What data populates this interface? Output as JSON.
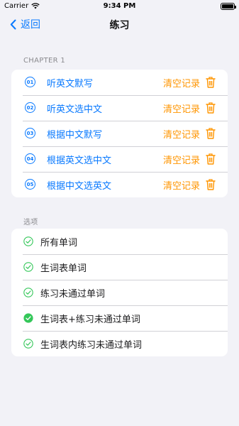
{
  "status": {
    "carrier": "Carrier",
    "time": "9:34 PM"
  },
  "nav": {
    "back_label": "返回",
    "title": "练习"
  },
  "chapter": {
    "header": "CHAPTER 1",
    "items": [
      {
        "num": "01",
        "label": "听英文默写",
        "clear": "清空记录"
      },
      {
        "num": "02",
        "label": "听英文选中文",
        "clear": "清空记录"
      },
      {
        "num": "03",
        "label": "根据中文默写",
        "clear": "清空记录"
      },
      {
        "num": "04",
        "label": "根据英文选中文",
        "clear": "清空记录"
      },
      {
        "num": "05",
        "label": "根据中文选英文",
        "clear": "清空记录"
      }
    ]
  },
  "options": {
    "header": "选项",
    "items": [
      {
        "label": "所有单词",
        "selected": false
      },
      {
        "label": "生词表单词",
        "selected": false
      },
      {
        "label": "练习未通过单词",
        "selected": false
      },
      {
        "label": "生词表+练习未通过单词",
        "selected": true
      },
      {
        "label": "生词表内练习未通过单词",
        "selected": false
      }
    ]
  },
  "colors": {
    "accent": "#0a7aff",
    "clear": "#ff9500",
    "check": "#34c759",
    "background": "#f2f2f7"
  }
}
